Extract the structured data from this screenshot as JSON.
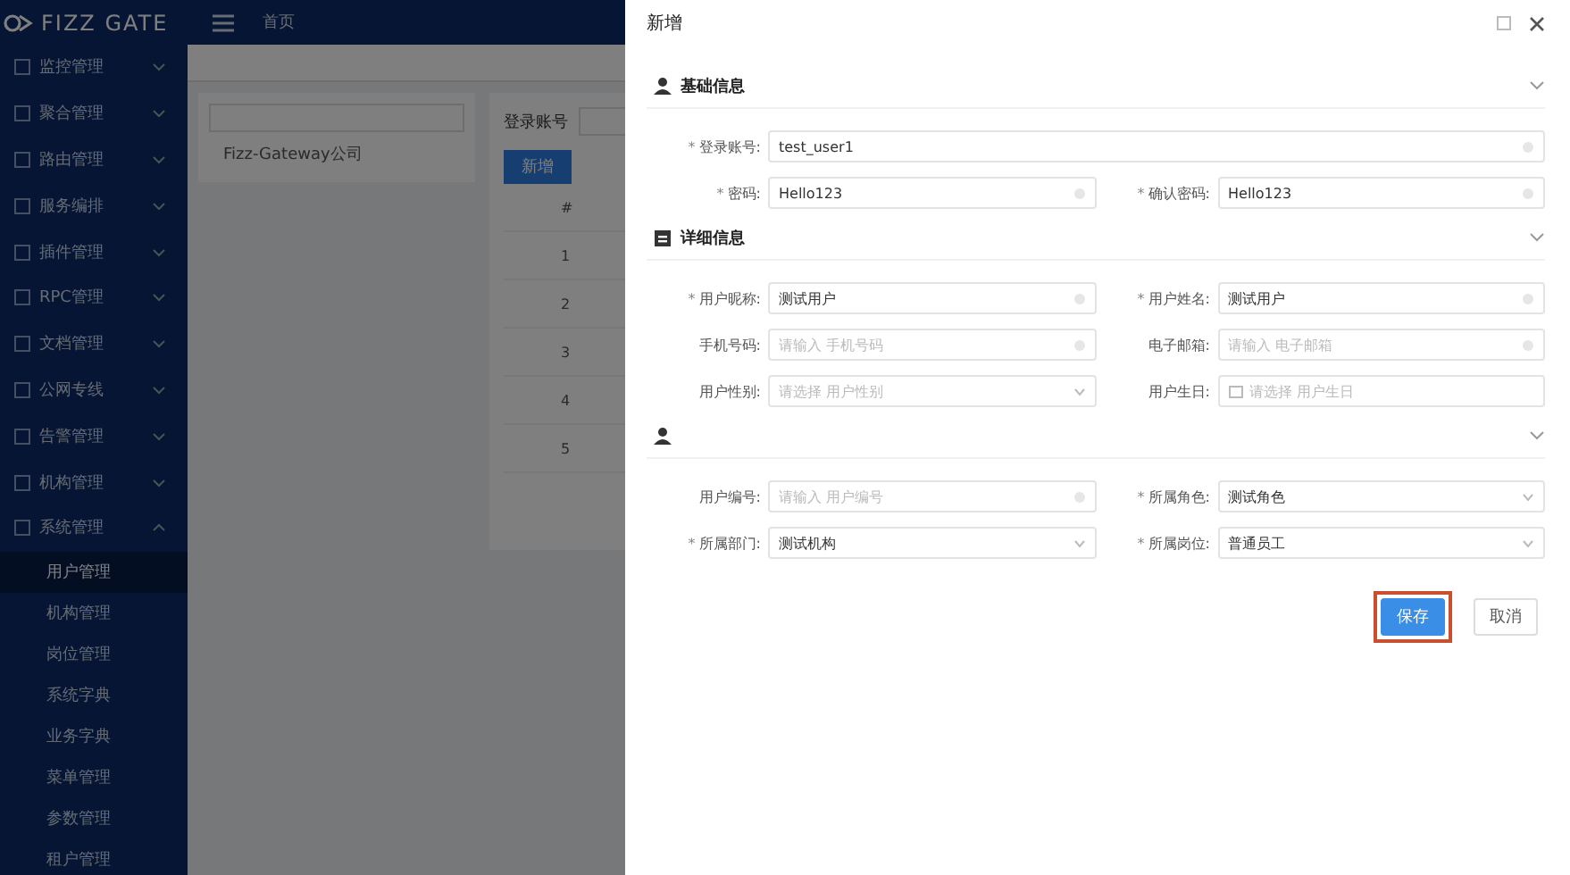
{
  "header": {
    "logo": "FIZZ GATE",
    "breadcrumb": "首页"
  },
  "sidebar": {
    "items": [
      {
        "label": "监控管理",
        "expanded": false
      },
      {
        "label": "聚合管理",
        "expanded": false
      },
      {
        "label": "路由管理",
        "expanded": false
      },
      {
        "label": "服务编排",
        "expanded": false
      },
      {
        "label": "插件管理",
        "expanded": false
      },
      {
        "label": "RPC管理",
        "expanded": false
      },
      {
        "label": "文档管理",
        "expanded": false
      },
      {
        "label": "公网专线",
        "expanded": false
      },
      {
        "label": "告警管理",
        "expanded": false
      },
      {
        "label": "机构管理",
        "expanded": false
      },
      {
        "label": "系统管理",
        "expanded": true,
        "children": [
          {
            "label": "用户管理",
            "selected": true
          },
          {
            "label": "机构管理",
            "selected": false
          },
          {
            "label": "岗位管理",
            "selected": false
          },
          {
            "label": "系统字典",
            "selected": false
          },
          {
            "label": "业务字典",
            "selected": false
          },
          {
            "label": "菜单管理",
            "selected": false
          },
          {
            "label": "参数管理",
            "selected": false
          },
          {
            "label": "租户管理",
            "selected": false
          }
        ]
      }
    ]
  },
  "tree": {
    "nodes": [
      "Fizz-Gateway公司"
    ]
  },
  "user_list": {
    "filter_label": "登录账号",
    "add_button": "新增",
    "columns": [
      "#"
    ],
    "rows": [
      {
        "index": "1"
      },
      {
        "index": "2"
      },
      {
        "index": "3"
      },
      {
        "index": "4"
      },
      {
        "index": "5"
      }
    ]
  },
  "dialog": {
    "title": "新增",
    "sections": [
      {
        "title": "基础信息",
        "expanded": true,
        "rows": [
          [
            {
              "label": "登录账号:",
              "required_mark": "*",
              "kind": "input",
              "value": "test_user1"
            }
          ],
          [
            {
              "label": "密码:",
              "required_mark": "*",
              "kind": "input",
              "value": "Hello123"
            },
            {
              "label": "确认密码:",
              "required_mark": "*",
              "kind": "input",
              "value": "Hello123"
            }
          ]
        ]
      },
      {
        "title": "详细信息",
        "expanded": true,
        "rows": [
          [
            {
              "label": "用户昵称:",
              "required_mark": "*",
              "kind": "input",
              "value": "测试用户"
            },
            {
              "label": "用户姓名:",
              "required_mark": "*",
              "kind": "input",
              "value": "测试用户"
            }
          ],
          [
            {
              "label": "手机号码:",
              "kind": "input",
              "placeholder": "请输入 手机号码"
            },
            {
              "label": "电子邮箱:",
              "kind": "input",
              "placeholder": "请输入 电子邮箱"
            }
          ],
          [
            {
              "label": "用户性别:",
              "kind": "select",
              "placeholder": "请选择 用户性别"
            },
            {
              "label": "用户生日:",
              "kind": "date",
              "placeholder": "请选择 用户生日"
            }
          ]
        ]
      },
      {
        "expanded": true,
        "rows": [
          [
            {
              "label": "用户编号:",
              "kind": "input",
              "placeholder": "请输入 用户编号"
            },
            {
              "label": "所属角色:",
              "required_mark": "*",
              "kind": "select",
              "value": "测试角色"
            }
          ],
          [
            {
              "label": "所属部门:",
              "required_mark": "*",
              "kind": "select",
              "value": "测试机构"
            },
            {
              "label": "所属岗位:",
              "required_mark": "*",
              "kind": "select",
              "value": "普通员工"
            }
          ]
        ]
      }
    ],
    "buttons": [
      {
        "label": "保存",
        "kind": "primary",
        "highlighted": true
      },
      {
        "label": "取消",
        "kind": "default",
        "highlighted": false
      }
    ]
  }
}
